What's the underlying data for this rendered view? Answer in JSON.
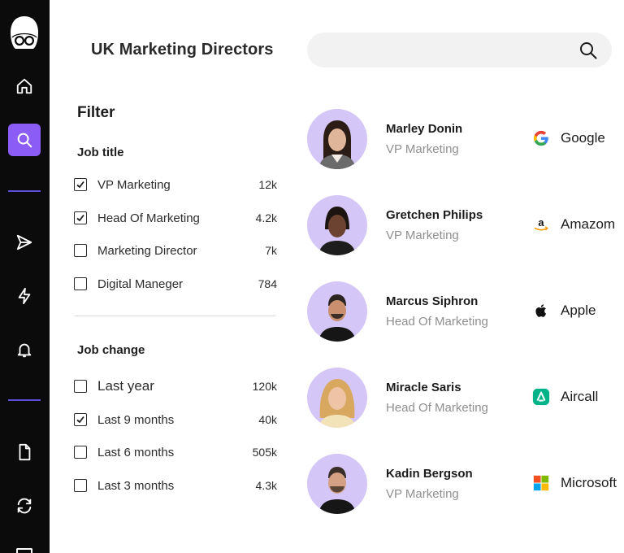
{
  "header": {
    "title": "UK Marketing Directors",
    "search": {
      "value": "",
      "placeholder": ""
    }
  },
  "sidebar": {
    "items": [
      {
        "icon": "home-icon"
      },
      {
        "icon": "search-icon",
        "active": true
      },
      {
        "icon": "send-icon"
      },
      {
        "icon": "lightning-icon"
      },
      {
        "icon": "bell-icon"
      },
      {
        "icon": "document-icon"
      },
      {
        "icon": "refresh-icon"
      }
    ],
    "accent": "#8b5cf6"
  },
  "filter": {
    "title": "Filter",
    "job_title": {
      "label": "Job title",
      "options": [
        {
          "label": "VP Marketing",
          "count": "12k",
          "checked": true
        },
        {
          "label": "Head Of Marketing",
          "count": "4.2k",
          "checked": true
        },
        {
          "label": "Marketing Director",
          "count": "7k",
          "checked": false
        },
        {
          "label": "Digital Maneger",
          "count": "784",
          "checked": false
        }
      ]
    },
    "job_change": {
      "label": "Job change",
      "options": [
        {
          "label": "Last year",
          "count": "120k",
          "checked": false
        },
        {
          "label": "Last 9 months",
          "count": "40k",
          "checked": true
        },
        {
          "label": "Last 6 months",
          "count": "505k",
          "checked": false
        },
        {
          "label": "Last 3 months",
          "count": "4.3k",
          "checked": false
        }
      ]
    }
  },
  "people": [
    {
      "name": "Marley Donin",
      "role": "VP Marketing",
      "company": "Google",
      "company_icon": "google-icon"
    },
    {
      "name": "Gretchen Philips",
      "role": "VP Marketing",
      "company": "Amazom",
      "company_icon": "amazon-icon"
    },
    {
      "name": "Marcus Siphron",
      "role": "Head Of Marketing",
      "company": "Apple",
      "company_icon": "apple-icon"
    },
    {
      "name": "Miracle Saris",
      "role": "Head Of Marketing",
      "company": "Aircall",
      "company_icon": "aircall-icon"
    },
    {
      "name": "Kadin Bergson",
      "role": "VP Marketing",
      "company": "Microsoft",
      "company_icon": "microsoft-icon"
    }
  ],
  "colors": {
    "avatar_bg": "#d4c6f6",
    "role_text": "#8f8f8f",
    "aircall": "#00b388"
  }
}
